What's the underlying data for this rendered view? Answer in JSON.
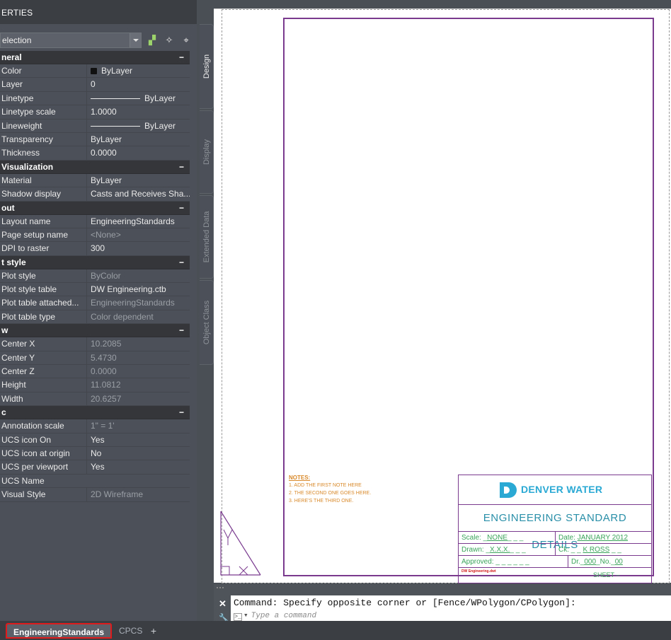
{
  "palette": {
    "title": "ERTIES",
    "selection": "election",
    "sections": [
      {
        "name": "neral",
        "rows": [
          {
            "label": "Color",
            "value": "ByLayer",
            "swatch": true
          },
          {
            "label": "Layer",
            "value": "0"
          },
          {
            "label": "Linetype",
            "value": "ByLayer",
            "line": true
          },
          {
            "label": "Linetype scale",
            "value": "1.0000"
          },
          {
            "label": "Lineweight",
            "value": "ByLayer",
            "line": true
          },
          {
            "label": "Transparency",
            "value": "ByLayer"
          },
          {
            "label": "Thickness",
            "value": "0.0000"
          }
        ]
      },
      {
        "name": "Visualization",
        "rows": [
          {
            "label": "Material",
            "value": "ByLayer"
          },
          {
            "label": "Shadow display",
            "value": "Casts and Receives Sha..."
          }
        ]
      },
      {
        "name": "out",
        "rows": [
          {
            "label": "Layout name",
            "value": "EngineeringStandards"
          },
          {
            "label": "Page setup name",
            "value": "<None>",
            "dim": true
          },
          {
            "label": "DPI to raster",
            "value": "300"
          }
        ]
      },
      {
        "name": "t style",
        "rows": [
          {
            "label": "Plot style",
            "value": "ByColor",
            "dim": true
          },
          {
            "label": "Plot style table",
            "value": "DW Engineering.ctb"
          },
          {
            "label": "Plot table attached...",
            "value": "EngineeringStandards",
            "dim": true
          },
          {
            "label": "Plot table type",
            "value": "Color dependent",
            "dim": true
          }
        ]
      },
      {
        "name": "w",
        "rows": [
          {
            "label": "Center X",
            "value": "10.2085",
            "dim": true
          },
          {
            "label": "Center Y",
            "value": "5.4730",
            "dim": true
          },
          {
            "label": "Center Z",
            "value": "0.0000",
            "dim": true
          },
          {
            "label": "Height",
            "value": "11.0812",
            "dim": true
          },
          {
            "label": "Width",
            "value": "20.6257",
            "dim": true
          }
        ]
      },
      {
        "name": "c",
        "rows": [
          {
            "label": "Annotation scale",
            "value": "1\" = 1'",
            "dim": true
          },
          {
            "label": "UCS icon On",
            "value": "Yes"
          },
          {
            "label": "UCS icon at origin",
            "value": "No"
          },
          {
            "label": "UCS per viewport",
            "value": "Yes"
          },
          {
            "label": "UCS Name",
            "value": ""
          },
          {
            "label": "Visual Style",
            "value": "2D Wireframe",
            "dim": true
          }
        ]
      }
    ],
    "vtabs": [
      "Design",
      "Display",
      "Extended Data",
      "Object Class"
    ]
  },
  "drawing": {
    "notes": {
      "title": "NOTES:",
      "items": [
        "1. ADD THE FIRST NOTE HERE",
        "2. THE SECOND ONE GOES HERE.",
        "3. HERE'S THE THIRD ONE."
      ]
    },
    "title_block": {
      "logo_text": "DENVER WATER",
      "title": "ENGINEERING STANDARD DETAILS",
      "scale_label": "Scale:",
      "scale_value": "NONE",
      "date_label": "Date:",
      "date_value": "JANUARY 2012",
      "drawn_label": "Drawn:",
      "drawn_value": "X.X.X.",
      "ck_label": "Ck:",
      "ck_value": "K ROSS",
      "approved_label": "Approved:",
      "dr_label": "Dr.",
      "dr_value": "000",
      "no_label": "No.",
      "no_value": "00",
      "sheet_label": "SHEET",
      "sheet_value": "–",
      "file_tag": "DW Engineering.dwt"
    }
  },
  "command": {
    "history": "Command: Specify opposite corner or [Fence/WPolygon/CPolygon]:",
    "placeholder": "Type a command"
  },
  "layout_tabs": [
    {
      "label": "EngineeringStandards",
      "active": true
    },
    {
      "label": "CPCS",
      "active": false
    }
  ],
  "colors": {
    "sheet_border": "#7a3b8f",
    "notes": "#d9892a",
    "logo": "#2aa9d4",
    "titleblock_text": "#3aa45a",
    "active_tab_highlight": "#e01b1b"
  }
}
